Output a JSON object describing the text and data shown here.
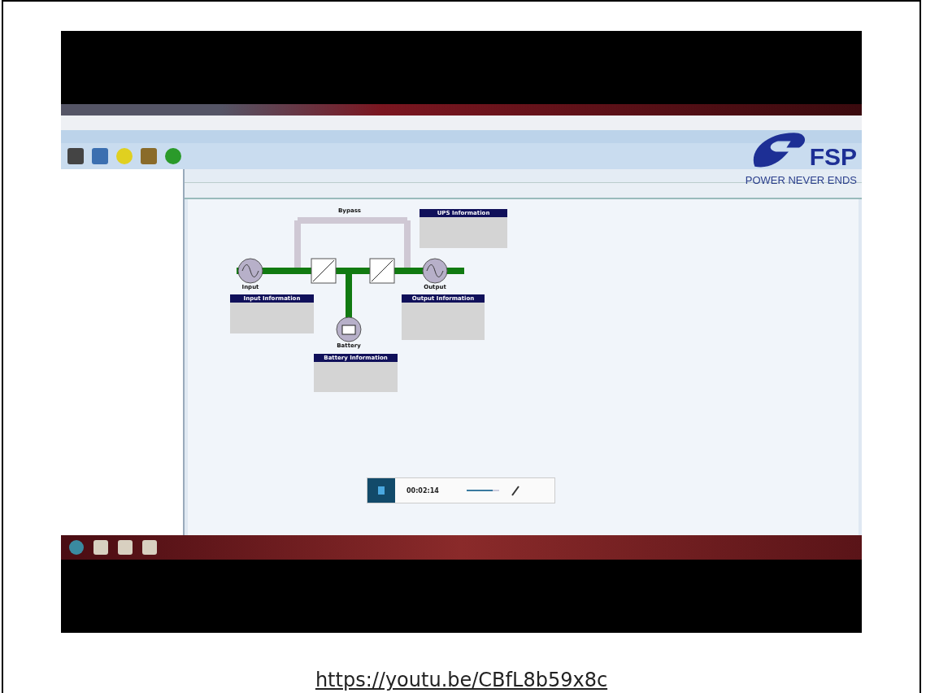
{
  "logo": {
    "brand": "FSP",
    "slogan": "POWER NEVER ENDS"
  },
  "diagram": {
    "bypass_label": "Bypass",
    "nodes": [
      {
        "kind": "input",
        "label": "Input"
      },
      {
        "kind": "output",
        "label": "Output"
      },
      {
        "kind": "battery",
        "label": "Battery"
      }
    ],
    "info_boxes": [
      {
        "kind": "ups",
        "title": "UPS Information"
      },
      {
        "kind": "input",
        "title": "Input Information"
      },
      {
        "kind": "output",
        "title": "Output Information"
      },
      {
        "kind": "battery",
        "title": "Battery Information"
      }
    ]
  },
  "recorder": {
    "time": "00:02:14",
    "volume": {
      "level": 0.8
    }
  },
  "link": "https://youtu.be/CBfL8b59x8c"
}
